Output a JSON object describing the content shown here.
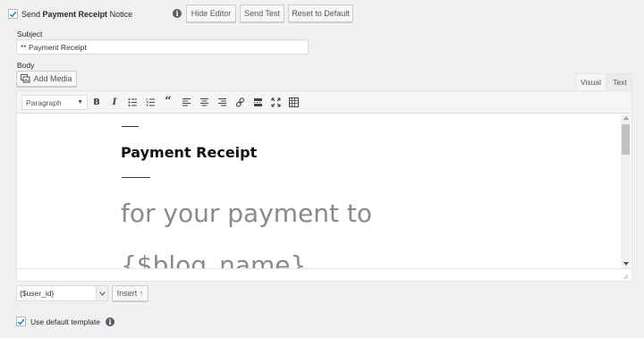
{
  "notice": {
    "label_prefix": "Send ",
    "label_bold": "Payment Receipt",
    "label_suffix": " Notice"
  },
  "actions": {
    "hide_editor": "Hide Editor",
    "send_test": "Send Test",
    "reset": "Reset to Default"
  },
  "subject": {
    "label": "Subject",
    "value": "** Payment Receipt"
  },
  "body": {
    "label": "Body",
    "add_media": "Add Media"
  },
  "tabs": {
    "visual": "Visual",
    "text": "Text"
  },
  "toolbar": {
    "format_select": "Paragraph"
  },
  "content": {
    "heading": "Payment Receipt",
    "line1": "for your payment to",
    "line2": "{$blog_name}"
  },
  "footer": {
    "variable_select": "{$user_id}",
    "insert_button": "Insert ↑",
    "use_default_label": "Use default template"
  },
  "colors": {
    "accent": "#1e8cbe",
    "text_gray": "#8a8a8a"
  }
}
